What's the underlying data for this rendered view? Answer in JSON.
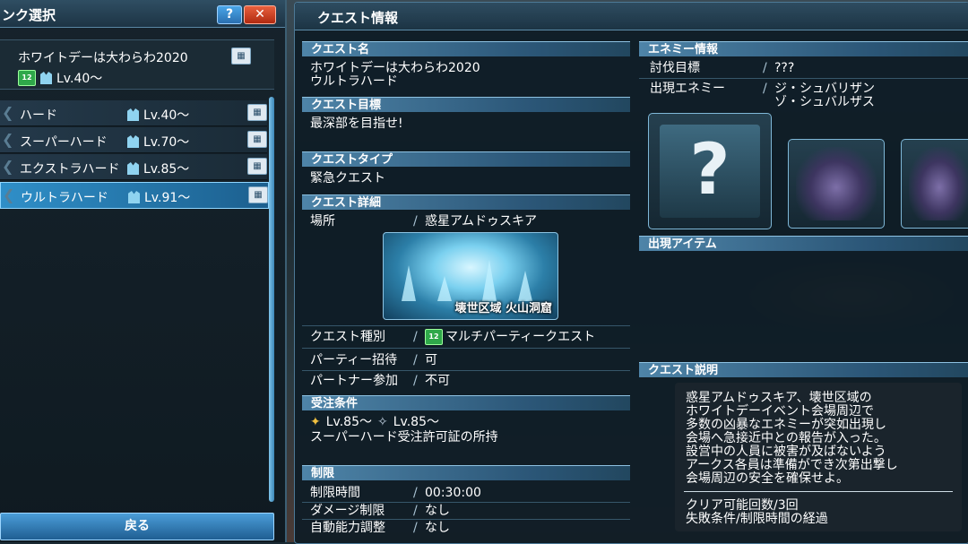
{
  "left_panel": {
    "title": "ンク選択",
    "help_label": "?",
    "close_label": "✕",
    "selected_quest": {
      "name": "ホワイトデーは大わらわ2020",
      "badge": "12",
      "level": "Lv.40～"
    },
    "ranks": [
      {
        "name": "ハード",
        "level": "Lv.40～"
      },
      {
        "name": "スーパーハード",
        "level": "Lv.70～"
      },
      {
        "name": "エクストラハード",
        "level": "Lv.85～"
      },
      {
        "name": "ウルトラハード",
        "level": "Lv.91～"
      }
    ],
    "back_label": "戻る"
  },
  "main": {
    "title": "クエスト情報",
    "quest_name_head": "クエスト名",
    "quest_name_line1": "ホワイトデーは大わらわ2020",
    "quest_name_line2": "ウルトラハード",
    "goal_head": "クエスト目標",
    "goal": "最深部を目指せ!",
    "type_head": "クエストタイプ",
    "type": "緊急クエスト",
    "detail_head": "クエスト詳細",
    "location_label": "場所",
    "location": "惑星アムドゥスキア",
    "image_caption": "壊世区域 火山洞窟",
    "kind_label": "クエスト種別",
    "kind_badge": "12",
    "kind": "マルチパーティークエスト",
    "party_invite_label": "パーティー招待",
    "party_invite": "可",
    "partner_label": "パートナー参加",
    "partner": "不可",
    "conditions_head": "受注条件",
    "cond_level_main": "Lv.85～",
    "cond_level_sub": "Lv.85～",
    "cond_permit": "スーパーハード受注許可証の所持",
    "limits_head": "制限",
    "time_label": "制限時間",
    "time": "00:30:00",
    "damage_label": "ダメージ制限",
    "damage": "なし",
    "auto_label": "自動能力調整",
    "auto": "なし",
    "enemy_head": "エネミー情報",
    "target_label": "討伐目標",
    "target": "???",
    "enemies_label": "出現エネミー",
    "enemy1": "ジ・シュバリザン",
    "enemy2": "ゾ・シュバルザス",
    "unknown_mark": "?",
    "items_head": "出現アイテム",
    "desc_head": "クエスト説明",
    "description": [
      "惑星アムドゥスキア、壊世区域の",
      "ホワイトデーイベント会場周辺で",
      "多数の凶暴なエネミーが突如出現し",
      "会場へ急接近中との報告が入った。",
      "設営中の人員に被害が及ばないよう",
      "アークス各員は準備ができ次第出撃し",
      "会場周辺の安全を確保せよ。"
    ],
    "clear_count": "クリア可能回数/3回",
    "fail_condition": "失敗条件/制限時間の経過"
  },
  "slash": "/"
}
